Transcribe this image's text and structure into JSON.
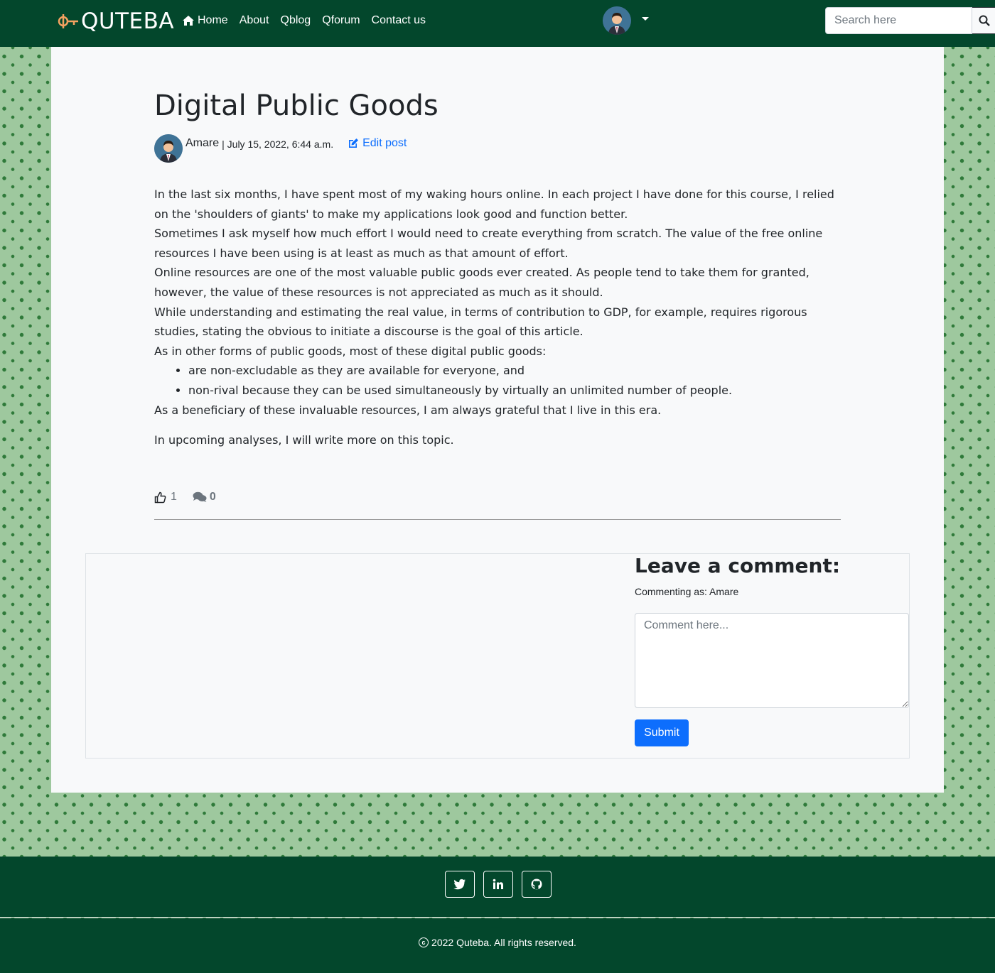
{
  "nav": {
    "brand": "QUTEBA",
    "links": [
      "Home",
      "About",
      "Qblog",
      "Qforum",
      "Contact us"
    ],
    "search_placeholder": "Search here"
  },
  "post": {
    "title": "Digital Public Goods",
    "author": "Amare",
    "date": "| July 15, 2022, 6:44 a.m.",
    "edit_label": "Edit post",
    "paragraphs": [
      "In the last six months, I have spent most of my waking hours online. In each project I have done for this course, I relied on the 'shoulders of giants' to make my applications look good and function better.",
      "Sometimes I ask myself how much effort I would need to create everything from scratch. The value of the free online resources I have been using is at least as much as that amount of effort.",
      "Online resources are one of the most valuable public goods ever created. As people tend to take them for granted, however, the value of these resources is not appreciated as much as it should.",
      "While understanding and estimating the real value, in terms of contribution to GDP, for example, requires rigorous studies, stating the obvious to initiate a discourse is the goal of this article.",
      "As in other forms of public goods, most of these digital public goods:"
    ],
    "bullets": [
      "are non-excludable as they are available for everyone, and",
      "non-rival because they can be used simultaneously by virtually an unlimited number of people."
    ],
    "closing": " As a beneficiary of these invaluable resources, I am always grateful that I live in this era.",
    "final": "In upcoming analyses, I will write more on this topic.",
    "likes": "1",
    "comments": "0"
  },
  "comment_form": {
    "heading": "Leave a comment:",
    "commenting_as": "Commenting as: Amare",
    "placeholder": "Comment here...",
    "submit_label": "Submit"
  },
  "footer": {
    "social": [
      "twitter-icon",
      "linkedin-icon",
      "github-icon"
    ],
    "copyright": "2022 Quteba. All rights reserved."
  },
  "colors": {
    "nav_bg": "#03472c",
    "pattern_bg": "#9ec89e",
    "link_blue": "#0d6efd"
  }
}
